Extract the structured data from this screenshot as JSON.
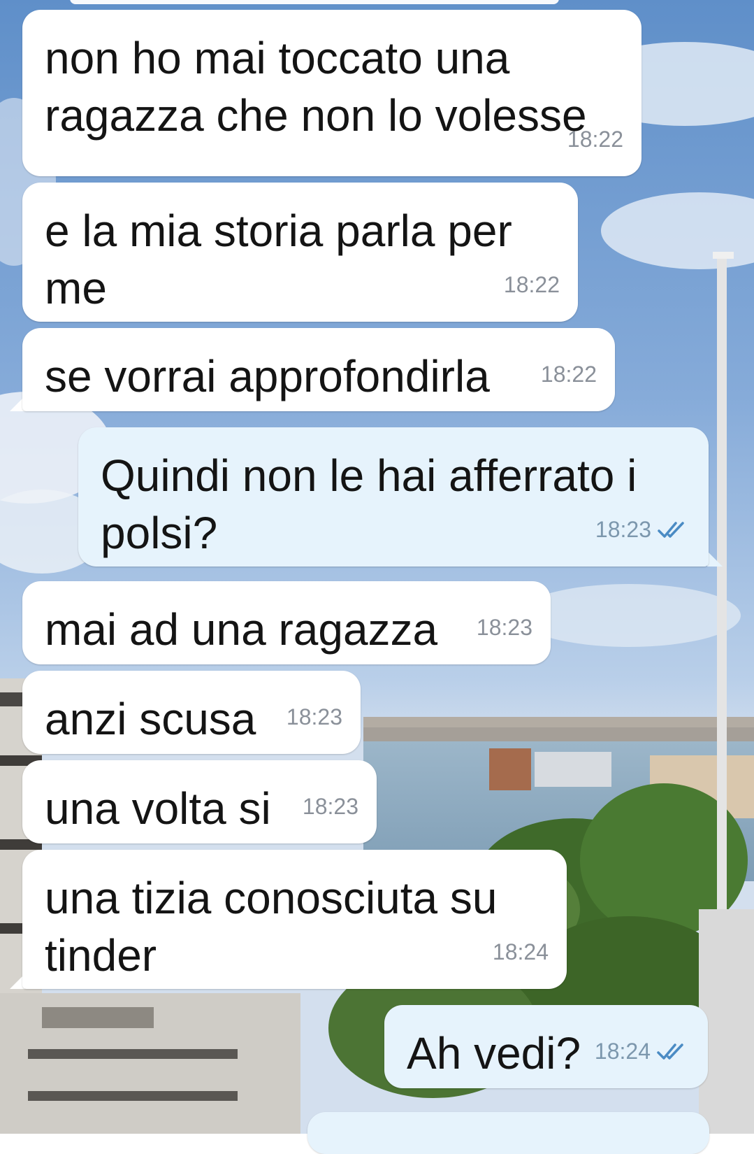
{
  "colors": {
    "incoming_bubble": "#ffffff",
    "outgoing_bubble": "#e6f3fc",
    "time_incoming": "#8a9099",
    "time_outgoing": "#7c97ad",
    "read_checks": "#4a8bc4"
  },
  "messages": [
    {
      "direction": "in",
      "text": "non ho mai toccato una\nragazza che non lo volesse",
      "time": "18:22"
    },
    {
      "direction": "in",
      "text": "e la mia storia parla per\nme",
      "time": "18:22"
    },
    {
      "direction": "in",
      "text": "se vorrai approfondirla",
      "time": "18:22"
    },
    {
      "direction": "out",
      "text": "Quindi non le hai afferrato i\npolsi?",
      "time": "18:23",
      "status_icon": "double-check-icon"
    },
    {
      "direction": "in",
      "text": "mai ad una ragazza",
      "time": "18:23"
    },
    {
      "direction": "in",
      "text": "anzi scusa",
      "time": "18:23"
    },
    {
      "direction": "in",
      "text": "una volta si",
      "time": "18:23"
    },
    {
      "direction": "in",
      "text": "una tizia conosciuta su\ntinder",
      "time": "18:24"
    },
    {
      "direction": "out",
      "text": "Ah vedi?",
      "time": "18:24",
      "status_icon": "double-check-icon"
    }
  ]
}
